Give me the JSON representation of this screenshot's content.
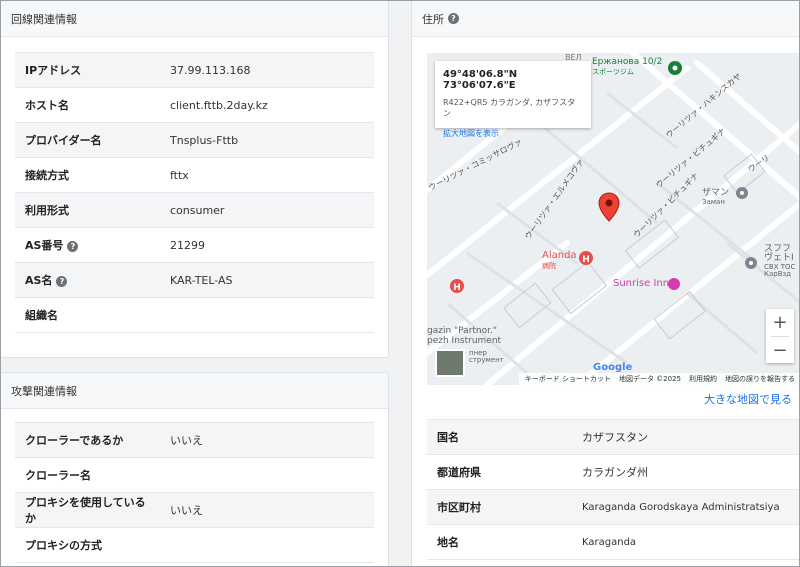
{
  "line_section": {
    "title": "回線関連情報",
    "rows": [
      {
        "label": "IPアドレス",
        "value": "37.99.113.168"
      },
      {
        "label": "ホスト名",
        "value": "client.fttb.2day.kz"
      },
      {
        "label": "プロバイダー名",
        "value": "Tnsplus-Fttb"
      },
      {
        "label": "接続方式",
        "value": "fttx"
      },
      {
        "label": "利用形式",
        "value": "consumer"
      },
      {
        "label": "AS番号",
        "value": "21299"
      },
      {
        "label": "AS名",
        "value": "KAR-TEL-AS"
      },
      {
        "label": "組織名",
        "value": ""
      }
    ]
  },
  "attack_section": {
    "title": "攻撃関連情報",
    "rows": [
      {
        "label": "クローラーであるか",
        "value": "いいえ"
      },
      {
        "label": "クローラー名",
        "value": ""
      },
      {
        "label": "プロキシを使用しているか",
        "value": "いいえ"
      },
      {
        "label": "プロキシの方式",
        "value": ""
      }
    ]
  },
  "address_section": {
    "title": "住所",
    "big_map_link": "大きな地図で見る",
    "rows": [
      {
        "label": "国名",
        "value": "カザフスタン"
      },
      {
        "label": "都道府県",
        "value": "カラガンダ州"
      },
      {
        "label": "市区町村",
        "value": "Karaganda Gorodskaya Administratsiya"
      },
      {
        "label": "地名",
        "value": "Karaganda"
      }
    ]
  },
  "map": {
    "coords": "49°48'06.8\"N 73°06'07.6\"E",
    "plus_code": "R422+QR5 カラガンダ, カザフスタン",
    "view_larger": "拡大地図を表示",
    "pois": {
      "gym": "Ержанова 10/2",
      "gym_sub": "スポーツジム",
      "hospital": "Alanda",
      "hospital_sub": "病院",
      "inn": "Sunrise Inn",
      "zaman": "ザマン",
      "zaman_sub": "Заман",
      "sfr": "スフフ",
      "sfr2": "ヴェトI",
      "sfr3": "СВХ ТОС",
      "sfr4": "КарВзд",
      "shop1": "gazin \"Partnor.\"",
      "shop2": "pezh Instrument",
      "shop3": "пнер",
      "shop4": "струмент",
      "top_street": "ВЕЛ"
    },
    "streets": {
      "s1": "ウーリツァ・コミッサロヴァ",
      "s2": "ウーリツァ・エルメコヴァ",
      "s3": "ウーリツァ・ハキンスカヤ",
      "s4": "ウーリツァ・ビチュギナ",
      "s5": "ウーリツァ・ビチュギナ",
      "s6": "ウーリ"
    },
    "google": "Google",
    "attrib": [
      "キーボード ショートカット",
      "地図データ ©2025",
      "利用規約",
      "地図の誤りを報告する"
    ],
    "zoom_in": "+",
    "zoom_out": "−"
  }
}
